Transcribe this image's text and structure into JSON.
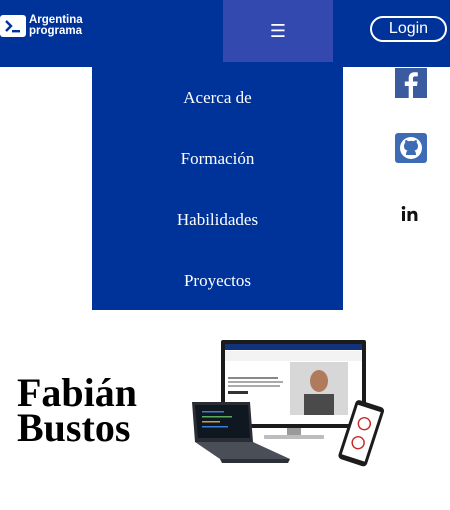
{
  "navbar": {
    "brand_line1": "Argentina",
    "brand_line2": "programa",
    "toggler_icon": "☰",
    "login_label": "Login",
    "bg_color": "#003399"
  },
  "menu": {
    "items": [
      {
        "label": "Acerca de"
      },
      {
        "label": "Formación"
      },
      {
        "label": "Habilidades"
      },
      {
        "label": "Proyectos"
      }
    ]
  },
  "social": {
    "facebook": "facebook-icon",
    "github": "github-icon",
    "linkedin": "linkedin-icon"
  },
  "hero": {
    "name_first": "Fabián",
    "name_last": "Bustos",
    "image": "devices-mockup"
  }
}
